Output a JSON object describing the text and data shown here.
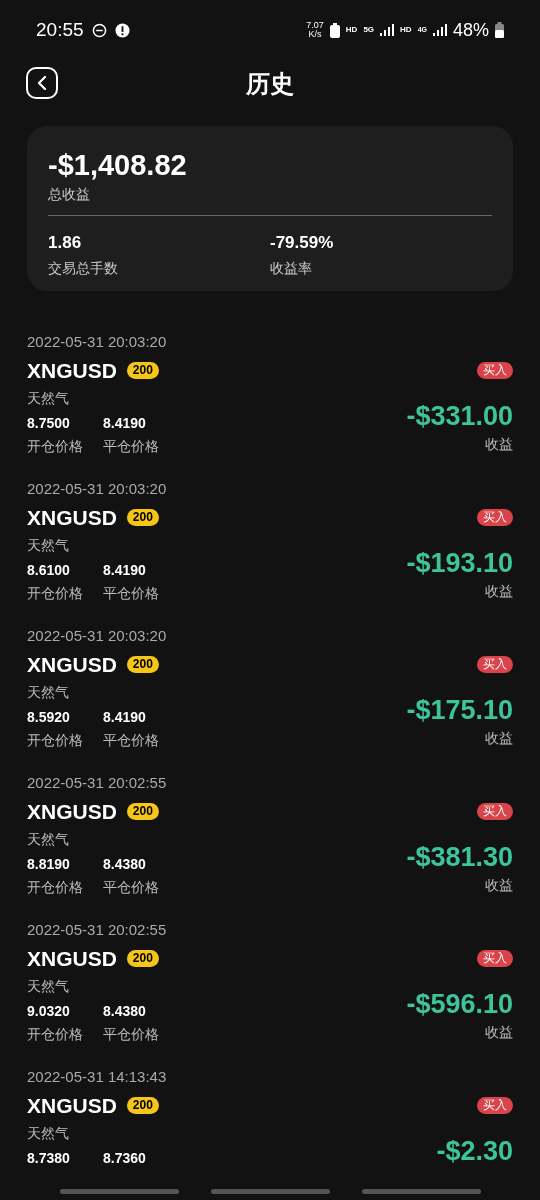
{
  "status_bar": {
    "time": "20:55",
    "speed_value": "7.07",
    "speed_unit": "K/s",
    "hd_1": "HD",
    "net_1": "5G",
    "hd_2": "HD",
    "net_2": "4G",
    "battery": "48%"
  },
  "header": {
    "title": "历史"
  },
  "summary": {
    "total_profit": "-$1,408.82",
    "total_profit_label": "总收益",
    "stats": [
      {
        "value": "1.86",
        "label": "交易总手数"
      },
      {
        "value": "-79.59%",
        "label": "收益率"
      }
    ]
  },
  "trades": [
    {
      "time": "2022-05-31 20:03:20",
      "symbol": "XNGUSD",
      "leverage": "200",
      "name": "天然气",
      "open_price": "8.7500",
      "close_price": "8.4190",
      "open_label": "开仓价格",
      "close_label": "平仓价格",
      "side": "买入",
      "profit": "-$331.00",
      "profit_label": "收益"
    },
    {
      "time": "2022-05-31 20:03:20",
      "symbol": "XNGUSD",
      "leverage": "200",
      "name": "天然气",
      "open_price": "8.6100",
      "close_price": "8.4190",
      "open_label": "开仓价格",
      "close_label": "平仓价格",
      "side": "买入",
      "profit": "-$193.10",
      "profit_label": "收益"
    },
    {
      "time": "2022-05-31 20:03:20",
      "symbol": "XNGUSD",
      "leverage": "200",
      "name": "天然气",
      "open_price": "8.5920",
      "close_price": "8.4190",
      "open_label": "开仓价格",
      "close_label": "平仓价格",
      "side": "买入",
      "profit": "-$175.10",
      "profit_label": "收益"
    },
    {
      "time": "2022-05-31 20:02:55",
      "symbol": "XNGUSD",
      "leverage": "200",
      "name": "天然气",
      "open_price": "8.8190",
      "close_price": "8.4380",
      "open_label": "开仓价格",
      "close_label": "平仓价格",
      "side": "买入",
      "profit": "-$381.30",
      "profit_label": "收益"
    },
    {
      "time": "2022-05-31 20:02:55",
      "symbol": "XNGUSD",
      "leverage": "200",
      "name": "天然气",
      "open_price": "9.0320",
      "close_price": "8.4380",
      "open_label": "开仓价格",
      "close_label": "平仓价格",
      "side": "买入",
      "profit": "-$596.10",
      "profit_label": "收益"
    },
    {
      "time": "2022-05-31 14:13:43",
      "symbol": "XNGUSD",
      "leverage": "200",
      "name": "天然气",
      "open_price": "8.7380",
      "close_price": "8.7360",
      "side": "买入",
      "profit": "-$2.30"
    }
  ]
}
